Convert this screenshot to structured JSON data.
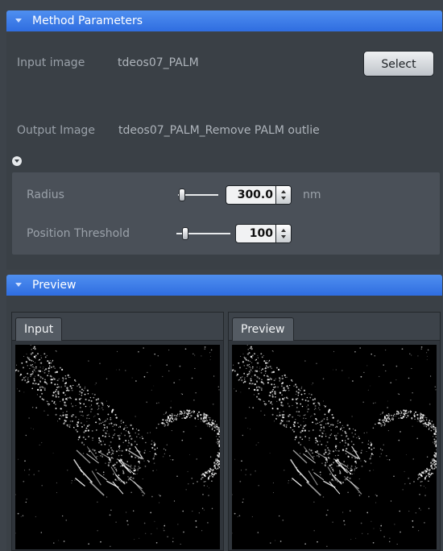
{
  "method_parameters": {
    "header": "Method Parameters",
    "input_label": "Input image",
    "input_value": "tdeos07_PALM",
    "select_label": "Select",
    "output_label": "Output Image",
    "output_value": "tdeos07_PALM_Remove PALM outlie",
    "expand_icon": "collapse-toggle-icon",
    "radius_label": "Radius",
    "radius_value": "300.0",
    "radius_unit": "nm",
    "position_threshold_label": "Position Threshold",
    "position_threshold_value": "100"
  },
  "preview": {
    "header": "Preview",
    "input_tab": "Input",
    "preview_tab": "Preview"
  },
  "colors": {
    "header_blue": "#3a7ae8",
    "panel_bg": "#3a4046",
    "subpanel_bg": "#4a5058"
  }
}
